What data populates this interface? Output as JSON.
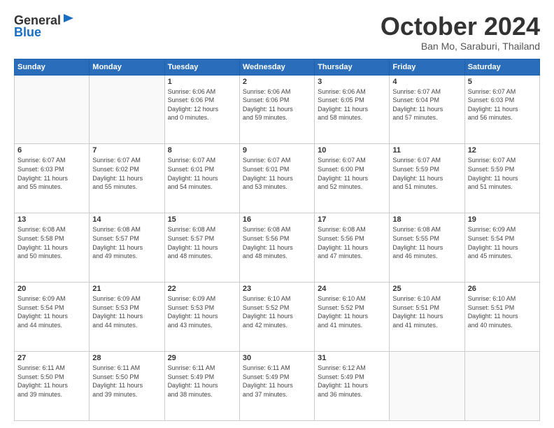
{
  "header": {
    "logo_general": "General",
    "logo_blue": "Blue",
    "month": "October 2024",
    "location": "Ban Mo, Saraburi, Thailand"
  },
  "days_of_week": [
    "Sunday",
    "Monday",
    "Tuesday",
    "Wednesday",
    "Thursday",
    "Friday",
    "Saturday"
  ],
  "weeks": [
    [
      {
        "day": "",
        "info": ""
      },
      {
        "day": "",
        "info": ""
      },
      {
        "day": "1",
        "info": "Sunrise: 6:06 AM\nSunset: 6:06 PM\nDaylight: 12 hours\nand 0 minutes."
      },
      {
        "day": "2",
        "info": "Sunrise: 6:06 AM\nSunset: 6:06 PM\nDaylight: 11 hours\nand 59 minutes."
      },
      {
        "day": "3",
        "info": "Sunrise: 6:06 AM\nSunset: 6:05 PM\nDaylight: 11 hours\nand 58 minutes."
      },
      {
        "day": "4",
        "info": "Sunrise: 6:07 AM\nSunset: 6:04 PM\nDaylight: 11 hours\nand 57 minutes."
      },
      {
        "day": "5",
        "info": "Sunrise: 6:07 AM\nSunset: 6:03 PM\nDaylight: 11 hours\nand 56 minutes."
      }
    ],
    [
      {
        "day": "6",
        "info": "Sunrise: 6:07 AM\nSunset: 6:03 PM\nDaylight: 11 hours\nand 55 minutes."
      },
      {
        "day": "7",
        "info": "Sunrise: 6:07 AM\nSunset: 6:02 PM\nDaylight: 11 hours\nand 55 minutes."
      },
      {
        "day": "8",
        "info": "Sunrise: 6:07 AM\nSunset: 6:01 PM\nDaylight: 11 hours\nand 54 minutes."
      },
      {
        "day": "9",
        "info": "Sunrise: 6:07 AM\nSunset: 6:01 PM\nDaylight: 11 hours\nand 53 minutes."
      },
      {
        "day": "10",
        "info": "Sunrise: 6:07 AM\nSunset: 6:00 PM\nDaylight: 11 hours\nand 52 minutes."
      },
      {
        "day": "11",
        "info": "Sunrise: 6:07 AM\nSunset: 5:59 PM\nDaylight: 11 hours\nand 51 minutes."
      },
      {
        "day": "12",
        "info": "Sunrise: 6:07 AM\nSunset: 5:59 PM\nDaylight: 11 hours\nand 51 minutes."
      }
    ],
    [
      {
        "day": "13",
        "info": "Sunrise: 6:08 AM\nSunset: 5:58 PM\nDaylight: 11 hours\nand 50 minutes."
      },
      {
        "day": "14",
        "info": "Sunrise: 6:08 AM\nSunset: 5:57 PM\nDaylight: 11 hours\nand 49 minutes."
      },
      {
        "day": "15",
        "info": "Sunrise: 6:08 AM\nSunset: 5:57 PM\nDaylight: 11 hours\nand 48 minutes."
      },
      {
        "day": "16",
        "info": "Sunrise: 6:08 AM\nSunset: 5:56 PM\nDaylight: 11 hours\nand 48 minutes."
      },
      {
        "day": "17",
        "info": "Sunrise: 6:08 AM\nSunset: 5:56 PM\nDaylight: 11 hours\nand 47 minutes."
      },
      {
        "day": "18",
        "info": "Sunrise: 6:08 AM\nSunset: 5:55 PM\nDaylight: 11 hours\nand 46 minutes."
      },
      {
        "day": "19",
        "info": "Sunrise: 6:09 AM\nSunset: 5:54 PM\nDaylight: 11 hours\nand 45 minutes."
      }
    ],
    [
      {
        "day": "20",
        "info": "Sunrise: 6:09 AM\nSunset: 5:54 PM\nDaylight: 11 hours\nand 44 minutes."
      },
      {
        "day": "21",
        "info": "Sunrise: 6:09 AM\nSunset: 5:53 PM\nDaylight: 11 hours\nand 44 minutes."
      },
      {
        "day": "22",
        "info": "Sunrise: 6:09 AM\nSunset: 5:53 PM\nDaylight: 11 hours\nand 43 minutes."
      },
      {
        "day": "23",
        "info": "Sunrise: 6:10 AM\nSunset: 5:52 PM\nDaylight: 11 hours\nand 42 minutes."
      },
      {
        "day": "24",
        "info": "Sunrise: 6:10 AM\nSunset: 5:52 PM\nDaylight: 11 hours\nand 41 minutes."
      },
      {
        "day": "25",
        "info": "Sunrise: 6:10 AM\nSunset: 5:51 PM\nDaylight: 11 hours\nand 41 minutes."
      },
      {
        "day": "26",
        "info": "Sunrise: 6:10 AM\nSunset: 5:51 PM\nDaylight: 11 hours\nand 40 minutes."
      }
    ],
    [
      {
        "day": "27",
        "info": "Sunrise: 6:11 AM\nSunset: 5:50 PM\nDaylight: 11 hours\nand 39 minutes."
      },
      {
        "day": "28",
        "info": "Sunrise: 6:11 AM\nSunset: 5:50 PM\nDaylight: 11 hours\nand 39 minutes."
      },
      {
        "day": "29",
        "info": "Sunrise: 6:11 AM\nSunset: 5:49 PM\nDaylight: 11 hours\nand 38 minutes."
      },
      {
        "day": "30",
        "info": "Sunrise: 6:11 AM\nSunset: 5:49 PM\nDaylight: 11 hours\nand 37 minutes."
      },
      {
        "day": "31",
        "info": "Sunrise: 6:12 AM\nSunset: 5:49 PM\nDaylight: 11 hours\nand 36 minutes."
      },
      {
        "day": "",
        "info": ""
      },
      {
        "day": "",
        "info": ""
      }
    ]
  ]
}
